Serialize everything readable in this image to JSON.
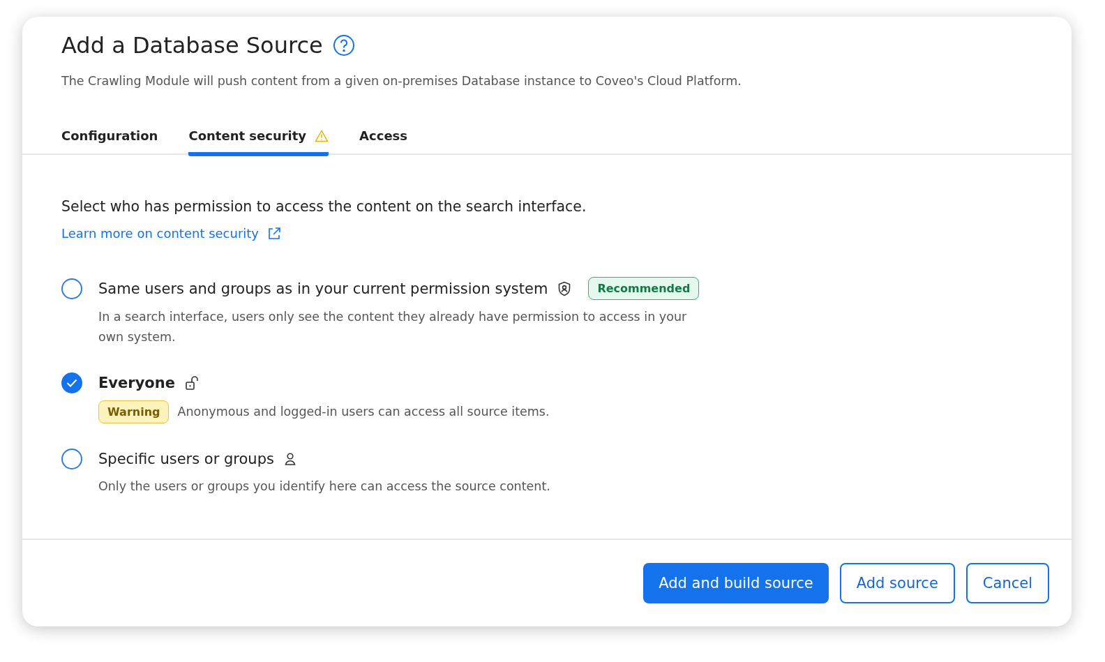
{
  "dialog": {
    "title": "Add a Database Source",
    "description": "The Crawling Module will push content from a given on-premises Database instance to Coveo's Cloud Platform."
  },
  "tabs": [
    {
      "label": "Configuration",
      "selected": false,
      "warning": false
    },
    {
      "label": "Content security",
      "selected": true,
      "warning": true
    },
    {
      "label": "Access",
      "selected": false,
      "warning": false
    }
  ],
  "content": {
    "prompt": "Select who has permission to access the content on the search interface.",
    "link": "Learn more on content security"
  },
  "options": [
    {
      "label": "Same users and groups as in your current permission system",
      "selected": false,
      "badge": {
        "text": "Recommended",
        "kind": "success"
      },
      "description": "In a search interface, users only see the content they already have permission to access in your own system."
    },
    {
      "label": "Everyone",
      "selected": true,
      "badge": {
        "text": "Warning",
        "kind": "warning"
      },
      "description": "Anonymous and logged-in users can access all source items."
    },
    {
      "label": "Specific users or groups",
      "selected": false,
      "description": "Only the users or groups you identify here can access the source content."
    }
  ],
  "buttons": [
    {
      "label": "Add and build source",
      "kind": "primary"
    },
    {
      "label": "Add source",
      "kind": "secondary"
    },
    {
      "label": "Cancel",
      "kind": "secondary"
    }
  ]
}
